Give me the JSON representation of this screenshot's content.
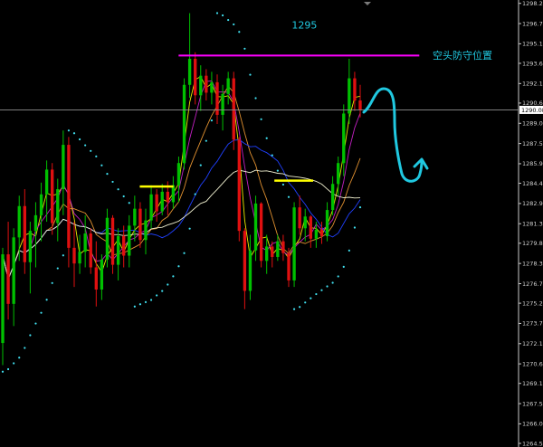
{
  "chart_data": {
    "type": "candlestick",
    "title": "",
    "ylim": [
      1264.5,
      1298.3
    ],
    "y_ticks": [
      {
        "value": 1298.25,
        "label": "1298.25"
      },
      {
        "value": 1296.7,
        "label": "1296.70"
      },
      {
        "value": 1295.15,
        "label": "1295.15"
      },
      {
        "value": 1293.65,
        "label": "1293.65"
      },
      {
        "value": 1292.1,
        "label": "1292.10"
      },
      {
        "value": 1290.6,
        "label": "1290.60"
      },
      {
        "value": 1289.05,
        "label": "1289.05"
      },
      {
        "value": 1287.5,
        "label": "1287.50"
      },
      {
        "value": 1285.95,
        "label": "1285.95"
      },
      {
        "value": 1284.45,
        "label": "1284.45"
      },
      {
        "value": 1282.9,
        "label": "1282.90"
      },
      {
        "value": 1281.35,
        "label": "1281.35"
      },
      {
        "value": 1279.85,
        "label": "1279.85"
      },
      {
        "value": 1278.3,
        "label": "1278.30"
      },
      {
        "value": 1276.75,
        "label": "1276.75"
      },
      {
        "value": 1275.25,
        "label": "1275.25"
      },
      {
        "value": 1273.7,
        "label": "1273.70"
      },
      {
        "value": 1272.15,
        "label": "1272.15"
      },
      {
        "value": 1270.6,
        "label": "1270.60"
      },
      {
        "value": 1269.1,
        "label": "1269.10"
      },
      {
        "value": 1267.55,
        "label": "1267.55"
      },
      {
        "value": 1266.0,
        "label": "1266.00"
      },
      {
        "value": 1264.5,
        "label": "1264.50"
      }
    ],
    "current_price": {
      "value": 1290.08,
      "label": "1290.08"
    },
    "colors": {
      "bull": "#00c000",
      "bear": "#e01010",
      "resistance": "#ff00ff",
      "support_marks": "#ffff00",
      "forecast": "#20c8e0",
      "sar": "#40e0f0",
      "ma_yellow": "#e8e800",
      "ma_magenta": "#c020c0",
      "ma_orange": "#e09030",
      "ma_blue": "#2040ff",
      "ma_white": "#f0f0d0",
      "price_line": "#909090"
    },
    "candles": [
      [
        1272.2,
        1279.5,
        1270.5,
        1279.0
      ],
      [
        1279.0,
        1281.5,
        1274.0,
        1275.2
      ],
      [
        1275.2,
        1281.0,
        1273.5,
        1280.3
      ],
      [
        1280.3,
        1283.5,
        1278.5,
        1282.7
      ],
      [
        1282.7,
        1284.0,
        1277.5,
        1278.4
      ],
      [
        1278.4,
        1281.5,
        1276.0,
        1280.8
      ],
      [
        1280.8,
        1283.0,
        1278.0,
        1282.0
      ],
      [
        1282.0,
        1284.5,
        1280.0,
        1283.6
      ],
      [
        1283.6,
        1286.2,
        1281.5,
        1285.5
      ],
      [
        1285.5,
        1286.0,
        1280.5,
        1281.4
      ],
      [
        1281.4,
        1284.8,
        1280.0,
        1284.0
      ],
      [
        1284.0,
        1288.5,
        1282.0,
        1287.4
      ],
      [
        1287.4,
        1288.0,
        1278.0,
        1279.5
      ],
      [
        1279.5,
        1281.5,
        1276.5,
        1278.3
      ],
      [
        1278.3,
        1280.5,
        1277.5,
        1279.2
      ],
      [
        1279.2,
        1282.0,
        1278.0,
        1280.6
      ],
      [
        1280.6,
        1281.0,
        1277.5,
        1278.0
      ],
      [
        1278.0,
        1280.0,
        1275.0,
        1276.3
      ],
      [
        1276.3,
        1279.0,
        1275.5,
        1278.6
      ],
      [
        1278.6,
        1282.5,
        1278.0,
        1281.8
      ],
      [
        1281.8,
        1282.0,
        1277.5,
        1278.2
      ],
      [
        1278.2,
        1281.0,
        1277.0,
        1280.4
      ],
      [
        1280.4,
        1281.2,
        1278.0,
        1278.9
      ],
      [
        1278.9,
        1282.0,
        1278.0,
        1281.2
      ],
      [
        1281.2,
        1283.5,
        1280.0,
        1282.5
      ],
      [
        1282.5,
        1283.0,
        1279.5,
        1280.1
      ],
      [
        1280.1,
        1282.5,
        1279.0,
        1281.6
      ],
      [
        1281.6,
        1284.3,
        1281.0,
        1283.6
      ],
      [
        1283.6,
        1284.0,
        1281.5,
        1282.3
      ],
      [
        1282.3,
        1284.4,
        1282.0,
        1283.8
      ],
      [
        1283.8,
        1284.6,
        1282.0,
        1283.0
      ],
      [
        1283.0,
        1285.0,
        1282.5,
        1284.3
      ],
      [
        1284.3,
        1286.5,
        1283.0,
        1286.0
      ],
      [
        1286.0,
        1292.5,
        1285.5,
        1292.0
      ],
      [
        1292.0,
        1297.5,
        1291.0,
        1294.0
      ],
      [
        1294.0,
        1294.5,
        1290.5,
        1291.2
      ],
      [
        1291.2,
        1293.5,
        1290.0,
        1292.7
      ],
      [
        1292.7,
        1293.2,
        1290.8,
        1291.4
      ],
      [
        1291.4,
        1293.0,
        1290.5,
        1292.2
      ],
      [
        1292.2,
        1292.8,
        1289.0,
        1289.7
      ],
      [
        1289.7,
        1292.0,
        1288.5,
        1291.3
      ],
      [
        1291.3,
        1293.0,
        1290.5,
        1292.5
      ],
      [
        1292.5,
        1293.0,
        1287.0,
        1287.8
      ],
      [
        1287.8,
        1288.0,
        1280.0,
        1280.8
      ],
      [
        1280.8,
        1281.0,
        1274.8,
        1276.2
      ],
      [
        1276.2,
        1280.5,
        1275.5,
        1279.3
      ],
      [
        1279.3,
        1283.5,
        1278.5,
        1282.9
      ],
      [
        1282.9,
        1283.0,
        1278.0,
        1278.5
      ],
      [
        1278.5,
        1280.5,
        1277.5,
        1279.6
      ],
      [
        1279.6,
        1280.0,
        1278.0,
        1278.8
      ],
      [
        1278.8,
        1280.5,
        1278.5,
        1280.0
      ],
      [
        1280.0,
        1280.5,
        1278.5,
        1279.1
      ],
      [
        1279.1,
        1279.5,
        1276.5,
        1277.0
      ],
      [
        1277.0,
        1283.0,
        1276.5,
        1282.6
      ],
      [
        1282.6,
        1283.5,
        1280.5,
        1281.0
      ],
      [
        1281.0,
        1282.5,
        1280.0,
        1281.9
      ],
      [
        1281.9,
        1282.0,
        1279.5,
        1280.2
      ],
      [
        1280.2,
        1281.5,
        1279.5,
        1280.9
      ],
      [
        1280.9,
        1281.5,
        1279.8,
        1280.4
      ],
      [
        1280.4,
        1283.0,
        1280.0,
        1282.4
      ],
      [
        1282.4,
        1285.0,
        1282.0,
        1284.4
      ],
      [
        1284.4,
        1286.5,
        1283.5,
        1286.0
      ],
      [
        1286.0,
        1290.5,
        1285.0,
        1289.8
      ],
      [
        1289.8,
        1294.0,
        1289.0,
        1292.5
      ],
      [
        1292.5,
        1293.0,
        1290.0,
        1290.8
      ],
      [
        1290.8,
        1292.0,
        1289.5,
        1290.1
      ]
    ],
    "annotations": [
      {
        "type": "hline",
        "color_key": "resistance",
        "value": 1294.25,
        "x_start": 0.345,
        "x_end": 0.81,
        "label": "1295",
        "label_value": 1296.6
      },
      {
        "type": "text",
        "color_key": "forecast",
        "text": "空头防守位置"
      },
      {
        "type": "support_mark",
        "color_key": "support_marks",
        "value": 1284.2,
        "x_start": 0.27,
        "x_end": 0.335
      },
      {
        "type": "support_mark",
        "color_key": "support_marks",
        "value": 1284.65,
        "x_start": 0.53,
        "x_end": 0.605
      }
    ]
  }
}
